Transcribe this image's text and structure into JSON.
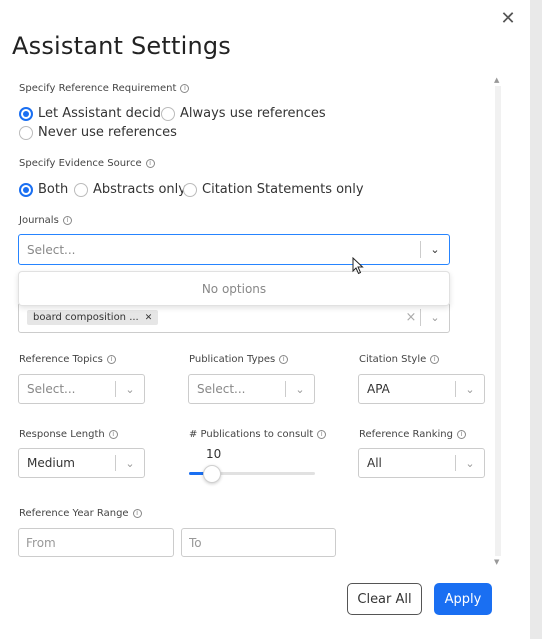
{
  "title": "Assistant Settings",
  "reference_requirement": {
    "label": "Specify Reference Requirement",
    "options": [
      "Let Assistant decide",
      "Always use references",
      "Never use references"
    ],
    "selected": "Let Assistant decide"
  },
  "evidence_source": {
    "label": "Specify Evidence Source",
    "options": [
      "Both",
      "Abstracts only",
      "Citation Statements only"
    ],
    "selected": "Both"
  },
  "journals": {
    "label": "Journals",
    "placeholder": "Select...",
    "dropdown_message": "No options"
  },
  "keywords": {
    "tag": "board composition ..."
  },
  "reference_topics": {
    "label": "Reference Topics",
    "placeholder": "Select..."
  },
  "publication_types": {
    "label": "Publication Types",
    "placeholder": "Select..."
  },
  "citation_style": {
    "label": "Citation Style",
    "value": "APA"
  },
  "response_length": {
    "label": "Response Length",
    "value": "Medium"
  },
  "publications_to_consult": {
    "label": "# Publications to consult",
    "value": "10",
    "fraction": 0.18
  },
  "reference_ranking": {
    "label": "Reference Ranking",
    "value": "All"
  },
  "year_range": {
    "label": "Reference Year Range",
    "from_placeholder": "From",
    "to_placeholder": "To"
  },
  "buttons": {
    "clear_all": "Clear All",
    "apply": "Apply"
  },
  "icons": {
    "close": "close-icon",
    "info": "info-icon",
    "chevron": "chevron-down-icon",
    "clear": "clear-icon"
  },
  "colors": {
    "accent": "#1a6ff2",
    "focus_border": "#2684ff"
  }
}
